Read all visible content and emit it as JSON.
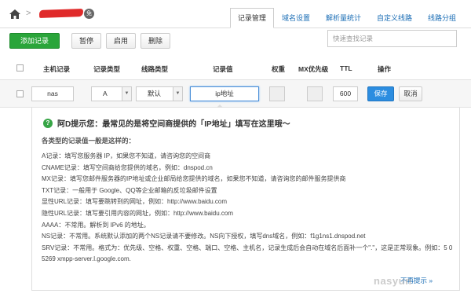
{
  "header": {
    "badge": "免",
    "tabs": [
      {
        "label": "记录管理",
        "active": true
      },
      {
        "label": "域名设置",
        "active": false
      },
      {
        "label": "解析量统计",
        "active": false
      },
      {
        "label": "自定义线路",
        "active": false
      },
      {
        "label": "线路分组",
        "active": false
      }
    ]
  },
  "toolbar": {
    "add": "添加记录",
    "pause": "暂停",
    "enable": "启用",
    "delete": "删除",
    "search_placeholder": "快速查找记录"
  },
  "columns": {
    "host": "主机记录",
    "type": "记录类型",
    "line": "线路类型",
    "value": "记录值",
    "weight": "权重",
    "mx": "MX优先级",
    "ttl": "TTL",
    "ops": "操作"
  },
  "edit_row": {
    "host": "nas",
    "type": "A",
    "line": "默认",
    "value": "ip地址",
    "ttl": "600",
    "save": "保存",
    "cancel": "取消"
  },
  "tip": {
    "title": "阿D提示您：最常见的是将空间商提供的「IP地址」填写在这里哦～",
    "subtitle": "各类型的记录值一般是这样的：",
    "lines": [
      "A记录：填写您服务器 IP，如果您不知道，请咨询您的空间商",
      "CNAME记录：填写空间商给您提供的域名，例如：dnspod.cn",
      "MX记录：填写您邮件服务器的IP地址或企业邮局给您提供的域名，如果您不知道，请咨询您的邮件服务提供商",
      "TXT记录：一般用于 Google、QQ等企业邮箱的反垃圾邮件设置",
      "显性URL记录：填写要跳转到的网址，例如：http://www.baidu.com",
      "隐性URL记录：填写要引用内容的网址，例如：http://www.baidu.com",
      "AAAA：不常用。解析到 IPv6 的地址。",
      "NS记录：不常用。系统默认添加的两个NS记录请不要修改。NS向下授权，填写dns域名，例如：f1g1ns1.dnspod.net",
      "SRV记录：不常用。格式为：优先级、空格、权重、空格、端口、空格、主机名，记录生成后会自动在域名后面补一个\".\"，这是正常现象。例如：5 0 5269 xmpp-server.l.google.com."
    ],
    "no_more": "不再提示",
    "arrow": "»"
  },
  "watermark": "nasyun"
}
